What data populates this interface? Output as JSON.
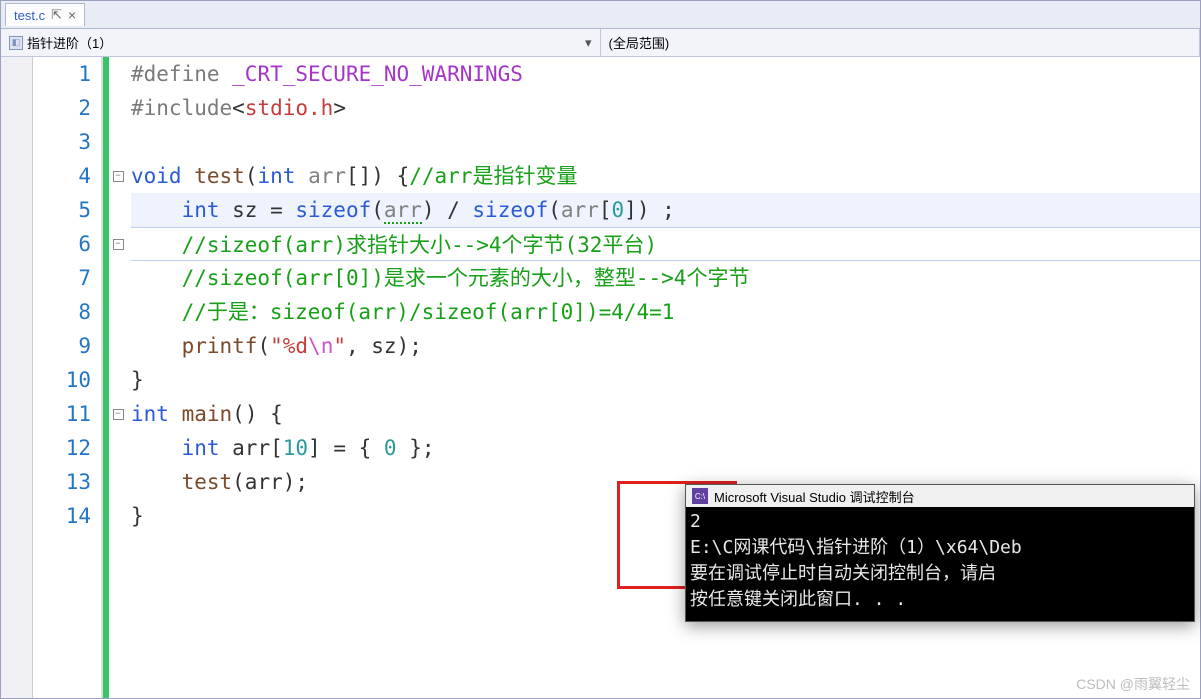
{
  "tab": {
    "filename": "test.c",
    "pin_glyph": "⇱",
    "close_glyph": "×"
  },
  "nav": {
    "left_icon": "◧",
    "left_label": "指针进阶（1）",
    "right_label": "(全局范围)",
    "dd_glyph": "▾"
  },
  "gutter": [
    "1",
    "2",
    "3",
    "4",
    "5",
    "6",
    "7",
    "8",
    "9",
    "10",
    "11",
    "12",
    "13",
    "14"
  ],
  "fold": {
    "minus": "−"
  },
  "code": {
    "l1": {
      "pp": "#define ",
      "mac": "_CRT_SECURE_NO_WARNINGS"
    },
    "l2": {
      "pp1": "#include",
      "ang1": "<",
      "hdr": "stdio.h",
      "ang2": ">"
    },
    "l4": {
      "kw1": "void",
      "sp1": " ",
      "fn": "test",
      "p1": "(",
      "kw2": "int",
      "sp2": " ",
      "id": "arr",
      "br": "[]",
      "p2": ") {",
      "cm": "//arr是指针变量"
    },
    "l5": {
      "pad": "    ",
      "kw": "int",
      "sp": " sz = ",
      "so1": "sizeof",
      "p1": "(",
      "id1": "arr",
      "p2": ") / ",
      "so2": "sizeof",
      "p3": "(",
      "id2": "arr",
      "br": "[",
      "num": "0",
      "br2": "]) ;"
    },
    "l6": {
      "pad": "    ",
      "cm": "//sizeof(arr)求指针大小-->4个字节(32平台)"
    },
    "l7": {
      "pad": "    ",
      "cm": "//sizeof(arr[0])是求一个元素的大小，整型-->4个字节"
    },
    "l8": {
      "pad": "    ",
      "cm": "//于是：sizeof(arr)/sizeof(arr[0])=4/4=1"
    },
    "l9": {
      "pad": "    ",
      "fn": "printf",
      "p1": "(",
      "q1": "\"",
      "fmt": "%d",
      "esc": "\\n",
      "q2": "\"",
      "rest": ", sz);"
    },
    "l10": {
      "txt": "}"
    },
    "l11": {
      "kw": "int",
      "sp": " ",
      "fn": "main",
      "rest": "() {"
    },
    "l12": {
      "pad": "    ",
      "kw": "int",
      "sp": " arr[",
      "num1": "10",
      "mid": "] = { ",
      "num2": "0",
      "end": " };"
    },
    "l13": {
      "pad": "    ",
      "fn": "test",
      "rest": "(arr);"
    },
    "l14": {
      "txt": "}"
    }
  },
  "console": {
    "title": "Microsoft Visual Studio 调试控制台",
    "icon_text": "C:\\",
    "out1": "2",
    "out2": "",
    "out3": "E:\\C网课代码\\指针进阶（1）\\x64\\Deb",
    "out4": "要在调试停止时自动关闭控制台，请启",
    "out5": "按任意键关闭此窗口. . ."
  },
  "watermark": "CSDN @雨翼轻尘"
}
